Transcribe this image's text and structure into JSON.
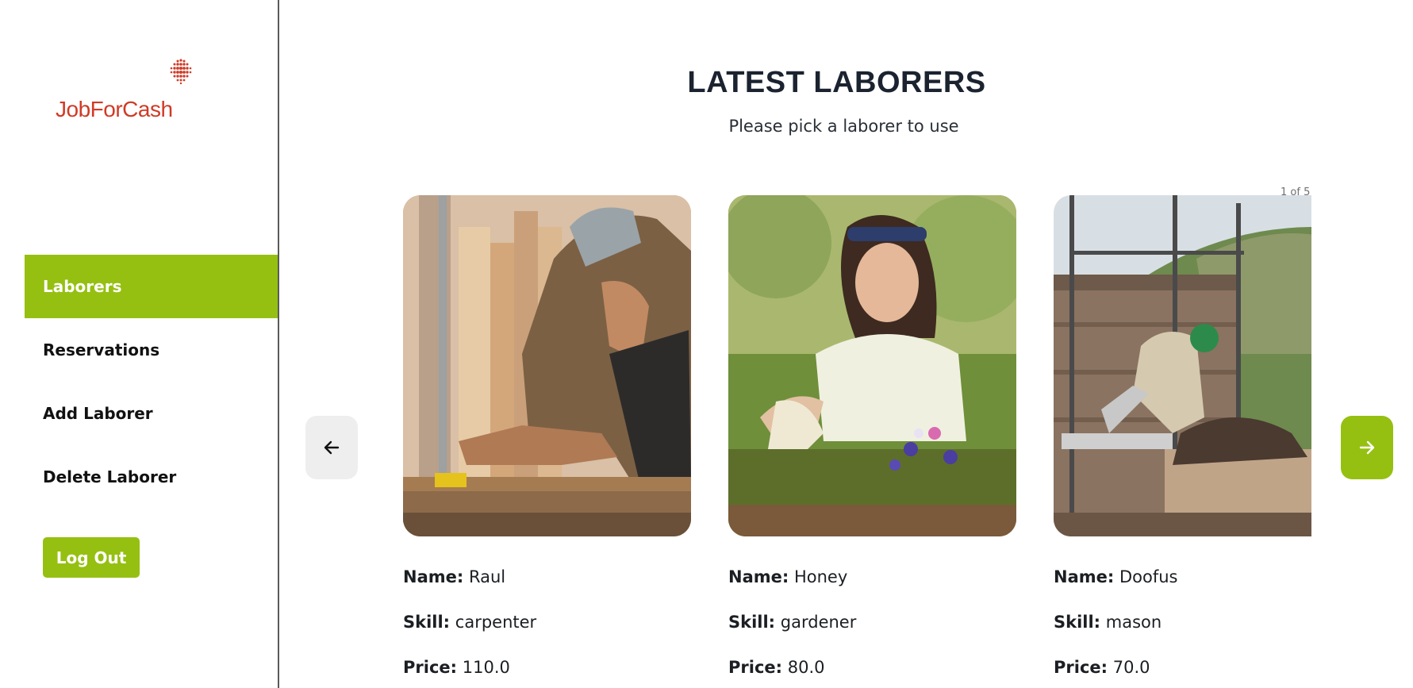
{
  "brand": {
    "name": "JobForCash",
    "accent": "#95c011",
    "logo_color": "#d13a26"
  },
  "sidebar": {
    "items": [
      {
        "label": "Laborers",
        "active": true
      },
      {
        "label": "Reservations",
        "active": false
      },
      {
        "label": "Add Laborer",
        "active": false
      },
      {
        "label": "Delete Laborer",
        "active": false
      }
    ],
    "logout_label": "Log Out"
  },
  "main": {
    "title": "LATEST LABORERS",
    "subtitle": "Please pick a laborer to use",
    "counter": "1 of 5",
    "prev_icon": "arrow-left-icon",
    "next_icon": "arrow-right-icon",
    "field_labels": {
      "name": "Name:",
      "skill": "Skill:",
      "price": "Price:"
    },
    "laborers": [
      {
        "name": "Raul",
        "skill": "carpenter",
        "price": "110.0"
      },
      {
        "name": "Honey",
        "skill": "gardener",
        "price": "80.0"
      },
      {
        "name": "Doofus",
        "skill": "mason",
        "price": "70.0"
      }
    ]
  }
}
